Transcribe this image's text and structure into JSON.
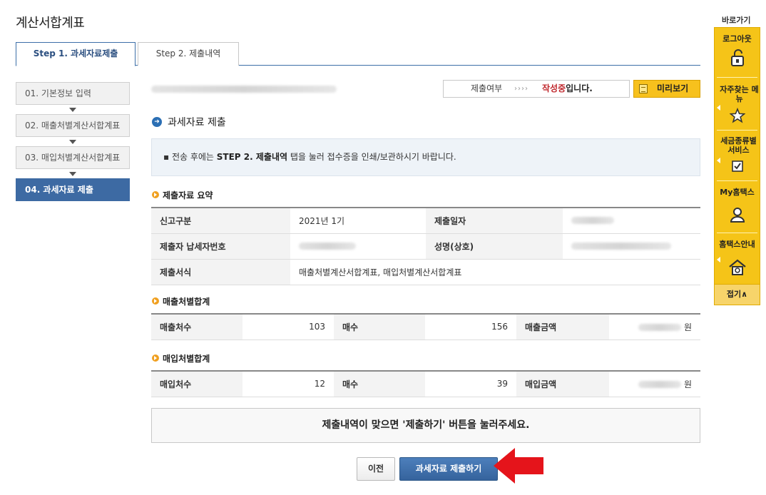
{
  "page_title": "계산서합계표",
  "tabs": [
    {
      "label": "Step 1. 과세자료제출",
      "active": true
    },
    {
      "label": "Step 2. 제출내역",
      "active": false
    }
  ],
  "steps": [
    {
      "label": "01. 기본정보 입력"
    },
    {
      "label": "02. 매출처별계산서합계표"
    },
    {
      "label": "03. 매입처별계산서합계표"
    },
    {
      "label": "04. 과세자료 제출"
    }
  ],
  "status": {
    "label": "제출여부",
    "arrows": "››››",
    "value_red": "작성중",
    "value_suffix": "입니다."
  },
  "preview_button": "미리보기",
  "section_title": "과세자료 제출",
  "notice": {
    "prefix": "▪ 전송 후에는 ",
    "bold": "STEP 2. 제출내역",
    "suffix": " 탭을 눌러 접수증을 인쇄/보관하시기 바랍니다."
  },
  "summary": {
    "title": "제출자료 요약",
    "report_type_label": "신고구분",
    "report_type_value": "2021년 1기",
    "submit_date_label": "제출일자",
    "taxpayer_no_label": "제출자 납세자번호",
    "name_label": "성명(상호)",
    "form_label": "제출서식",
    "form_value": "매출처별계산서합계표, 매입처별계산서합계표"
  },
  "sales": {
    "title": "매출처별합계",
    "count_label": "매출처수",
    "count_value": "103",
    "sheets_label": "매수",
    "sheets_value": "156",
    "amount_label": "매출금액",
    "unit": "원"
  },
  "purchase": {
    "title": "매입처별합계",
    "count_label": "매입처수",
    "count_value": "12",
    "sheets_label": "매수",
    "sheets_value": "39",
    "amount_label": "매입금액",
    "unit": "원"
  },
  "confirm_text": "제출내역이 맞으면 '제출하기' 버튼을 눌러주세요.",
  "buttons": {
    "prev": "이전",
    "submit": "과세자료 제출하기"
  },
  "quickbar": {
    "title": "바로가기",
    "items": [
      {
        "label": "로그아웃"
      },
      {
        "label": "자주찾는 메뉴"
      },
      {
        "label": "세금종류별 서비스"
      },
      {
        "label": "My홈택스"
      },
      {
        "label": "홈택스안내"
      }
    ],
    "fold": "접기∧"
  }
}
